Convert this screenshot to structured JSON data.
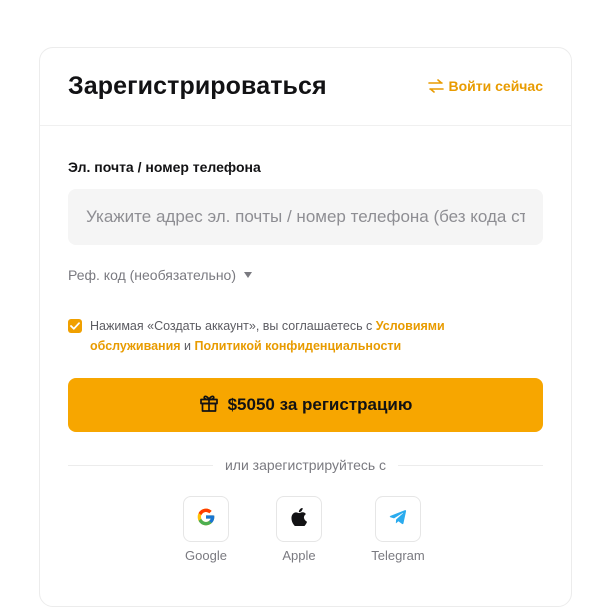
{
  "header": {
    "title": "Зарегистрироваться",
    "login_link": "Войти сейчас"
  },
  "form": {
    "email_label": "Эл. почта / номер телефона",
    "email_value": "",
    "email_placeholder": "Укажите адрес эл. почты / номер телефона (без кода страны)",
    "ref_code_label": "Реф. код (необязательно)",
    "terms": {
      "checked": true,
      "prefix": "Нажимая «Создать аккаунт», вы соглашаетесь с ",
      "terms_link": "Условиями обслуживания",
      "conjunction": " и ",
      "privacy_link": "Политикой конфиденциальности"
    },
    "submit_label": "$5050 за регистрацию"
  },
  "social": {
    "divider_text": "или зарегистрируйтесь с",
    "providers": [
      {
        "label": "Google",
        "icon": "google-icon"
      },
      {
        "label": "Apple",
        "icon": "apple-icon"
      },
      {
        "label": "Telegram",
        "icon": "telegram-icon"
      }
    ]
  },
  "colors": {
    "accent": "#f7a600",
    "link": "#e89b00",
    "input_bg": "#f5f5f5",
    "muted_text": "#7a7a80"
  }
}
